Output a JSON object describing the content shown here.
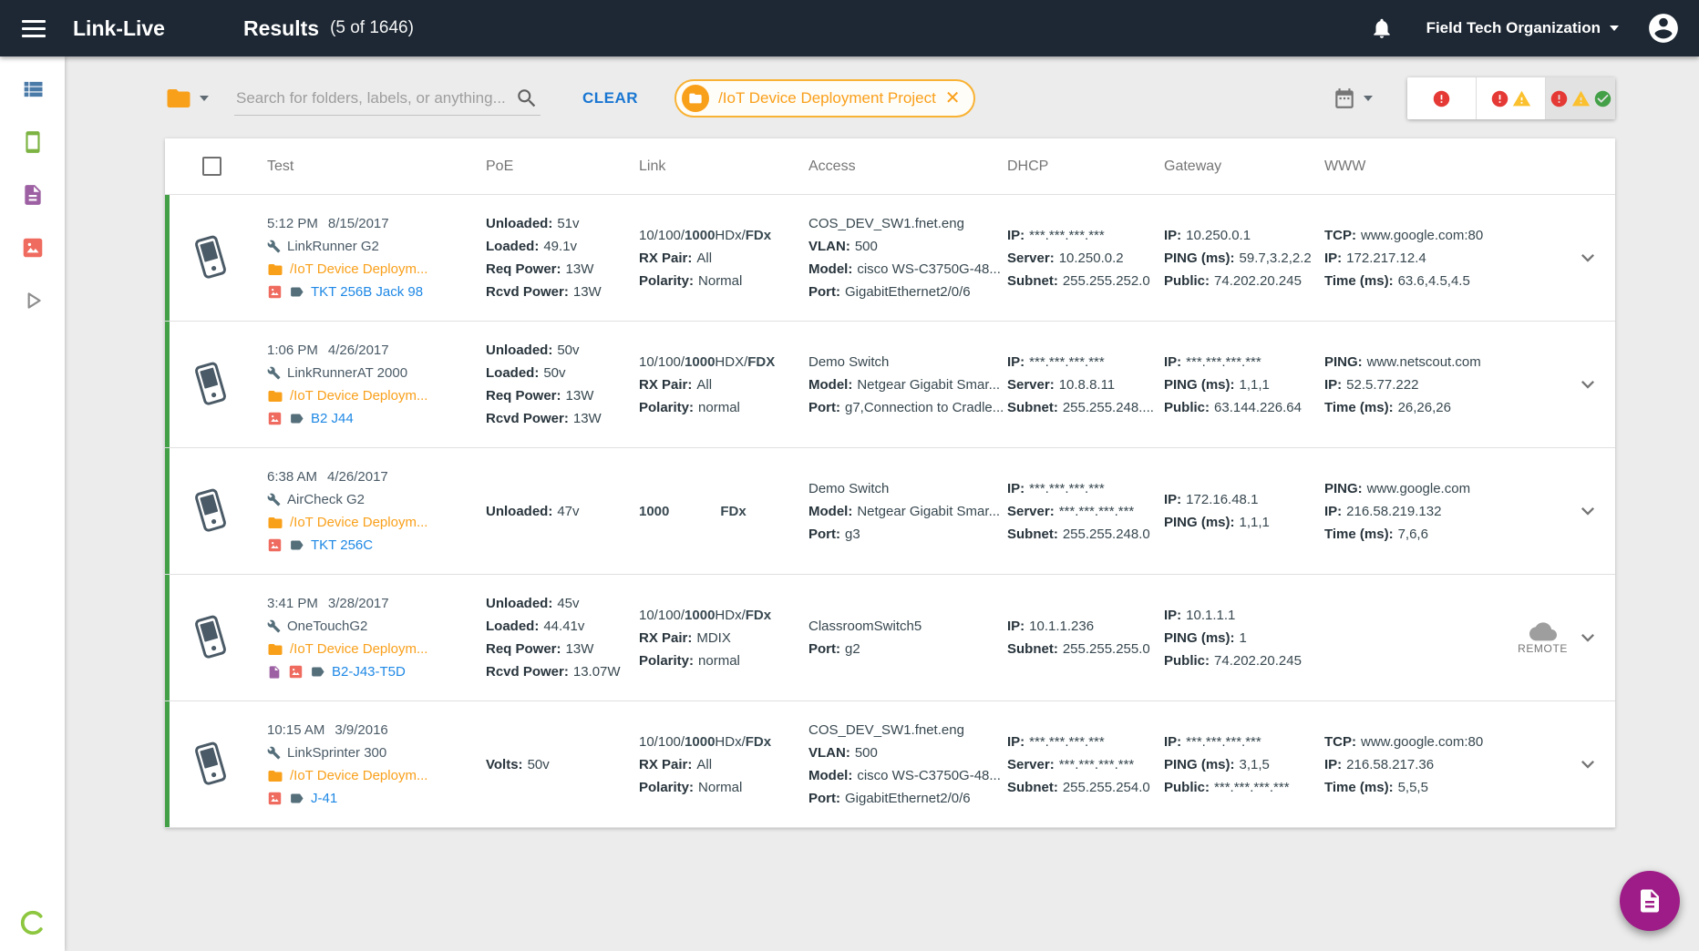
{
  "topbar": {
    "brand": "Link-Live",
    "title": "Results",
    "count": "(5 of 1646)",
    "org": "Field Tech Organization",
    "icons": [
      "menu-icon",
      "bell-icon",
      "caret-down-icon",
      "account-icon"
    ]
  },
  "sidebar": {
    "icons": [
      "view-list-icon",
      "smartphone-icon",
      "document-icon",
      "image-icon",
      "play-icon"
    ],
    "logo_icon": "ring-logo-icon"
  },
  "filters": {
    "search_placeholder": "Search for folders, labels, or anything...",
    "clear_label": "CLEAR",
    "chip": {
      "label": "/IoT Device Deployment Project",
      "icon": "folder-icon",
      "close_icon": "close-icon"
    },
    "folder_filter_icon": "folder-icon",
    "date_filter_icon": "calendar-icon",
    "status_toggles": [
      {
        "icons": [
          "error"
        ],
        "active": false
      },
      {
        "icons": [
          "error",
          "warning"
        ],
        "active": false
      },
      {
        "icons": [
          "error",
          "warning",
          "check"
        ],
        "active": true
      }
    ]
  },
  "table": {
    "columns": [
      "Test",
      "PoE",
      "Link",
      "Access",
      "DHCP",
      "Gateway",
      "WWW"
    ],
    "remote_label": "REMOTE",
    "rows": [
      {
        "time": "5:12 PM",
        "date": "8/15/2017",
        "device": "LinkRunner G2",
        "folder": "/IoT Device Deploym...",
        "label": "TKT 256B Jack 98",
        "label_icons": [
          "image",
          "tag"
        ],
        "poe": [
          {
            "label": "Unloaded:",
            "value": "51v"
          },
          {
            "label": "Loaded:",
            "value": "49.1v"
          },
          {
            "label": "Req Power:",
            "value": "13W"
          },
          {
            "label": "Rcvd Power:",
            "value": "13W"
          }
        ],
        "link_segments": [
          {
            "t": "10/100/"
          },
          {
            "t": "1000",
            "b": true
          },
          {
            "t": "HDx/"
          },
          {
            "t": "FDx",
            "b": true
          }
        ],
        "link_lines": [
          {
            "label": "RX Pair:",
            "value": "All"
          },
          {
            "label": "Polarity:",
            "value": "Normal"
          }
        ],
        "access": [
          {
            "value": "COS_DEV_SW1.fnet.eng"
          },
          {
            "label": "VLAN:",
            "value": "500"
          },
          {
            "label": "Model:",
            "value": "cisco WS-C3750G-48..."
          },
          {
            "label": "Port:",
            "value": "GigabitEthernet2/0/6"
          }
        ],
        "dhcp": [
          {
            "label": "IP:",
            "value": "***.***.***.***"
          },
          {
            "label": "Server:",
            "value": "10.250.0.2"
          },
          {
            "label": "Subnet:",
            "value": "255.255.252.0"
          }
        ],
        "gateway": [
          {
            "label": "IP:",
            "value": "10.250.0.1"
          },
          {
            "label": "PING (ms):",
            "value": "59.7,3.2,2.2"
          },
          {
            "label": "Public:",
            "value": "74.202.20.245"
          }
        ],
        "www": [
          {
            "label": "TCP:",
            "value": "www.google.com:80"
          },
          {
            "label": "IP:",
            "value": "172.217.12.4"
          },
          {
            "label": "Time (ms):",
            "value": "63.6,4.5,4.5"
          }
        ],
        "remote": false
      },
      {
        "time": "1:06 PM",
        "date": "4/26/2017",
        "device": "LinkRunnerAT 2000",
        "folder": "/IoT Device Deploym...",
        "label": "B2 J44",
        "label_icons": [
          "image",
          "tag"
        ],
        "poe": [
          {
            "label": "Unloaded:",
            "value": "50v"
          },
          {
            "label": "Loaded:",
            "value": "50v"
          },
          {
            "label": "Req Power:",
            "value": "13W"
          },
          {
            "label": "Rcvd Power:",
            "value": "13W"
          }
        ],
        "link_segments": [
          {
            "t": "10/100/"
          },
          {
            "t": "1000",
            "b": true
          },
          {
            "t": "HDX/"
          },
          {
            "t": "FDX",
            "b": true
          }
        ],
        "link_lines": [
          {
            "label": "RX Pair:",
            "value": "All"
          },
          {
            "label": "Polarity:",
            "value": "normal"
          }
        ],
        "access": [
          {
            "value": "Demo Switch"
          },
          {
            "label": "Model:",
            "value": "Netgear Gigabit Smar..."
          },
          {
            "label": "Port:",
            "value": "g7,Connection to Cradle..."
          }
        ],
        "dhcp": [
          {
            "label": "IP:",
            "value": "***.***.***.***"
          },
          {
            "label": "Server:",
            "value": "10.8.8.11"
          },
          {
            "label": "Subnet:",
            "value": "255.255.248...."
          }
        ],
        "gateway": [
          {
            "label": "IP:",
            "value": "***.***.***.***"
          },
          {
            "label": "PING (ms):",
            "value": "1,1,1"
          },
          {
            "label": "Public:",
            "value": "63.144.226.64"
          }
        ],
        "www": [
          {
            "label": "PING:",
            "value": "www.netscout.com"
          },
          {
            "label": "IP:",
            "value": "52.5.77.222"
          },
          {
            "label": "Time (ms):",
            "value": "26,26,26"
          }
        ],
        "remote": false
      },
      {
        "time": "6:38 AM",
        "date": "4/26/2017",
        "device": "AirCheck G2",
        "folder": "/IoT Device Deploym...",
        "label": "TKT 256C",
        "label_icons": [
          "image",
          "tag"
        ],
        "poe": [
          {
            "label": "Unloaded:",
            "value": "47v"
          }
        ],
        "link_segments": [
          {
            "t": "1000",
            "b": true,
            "gap": true
          },
          {
            "t": "FDx",
            "b": true
          }
        ],
        "link_lines": [],
        "access": [
          {
            "value": "Demo Switch"
          },
          {
            "label": "Model:",
            "value": "Netgear Gigabit Smar..."
          },
          {
            "label": "Port:",
            "value": "g3"
          }
        ],
        "dhcp": [
          {
            "label": "IP:",
            "value": "***.***.***.***"
          },
          {
            "label": "Server:",
            "value": "***.***.***.***"
          },
          {
            "label": "Subnet:",
            "value": "255.255.248.0"
          }
        ],
        "gateway": [
          {
            "label": "IP:",
            "value": "172.16.48.1"
          },
          {
            "label": "PING (ms):",
            "value": "1,1,1"
          }
        ],
        "www": [
          {
            "label": "PING:",
            "value": "www.google.com"
          },
          {
            "label": "IP:",
            "value": "216.58.219.132"
          },
          {
            "label": "Time (ms):",
            "value": "7,6,6"
          }
        ],
        "remote": false
      },
      {
        "time": "3:41 PM",
        "date": "3/28/2017",
        "device": "OneTouchG2",
        "folder": "/IoT Device Deploym...",
        "label": "B2-J43-T5D",
        "label_icons": [
          "file",
          "image",
          "tag"
        ],
        "poe": [
          {
            "label": "Unloaded:",
            "value": "45v"
          },
          {
            "label": "Loaded:",
            "value": "44.41v"
          },
          {
            "label": "Req Power:",
            "value": "13W"
          },
          {
            "label": "Rcvd Power:",
            "value": "13.07W"
          }
        ],
        "link_segments": [
          {
            "t": "10/100/"
          },
          {
            "t": "1000",
            "b": true
          },
          {
            "t": "HDx/"
          },
          {
            "t": "FDx",
            "b": true
          }
        ],
        "link_lines": [
          {
            "label": "RX Pair:",
            "value": "MDIX"
          },
          {
            "label": "Polarity:",
            "value": "normal"
          }
        ],
        "access": [
          {
            "value": "ClassroomSwitch5"
          },
          {
            "label": "Port:",
            "value": "g2"
          }
        ],
        "dhcp": [
          {
            "label": "IP:",
            "value": "10.1.1.236"
          },
          {
            "label": "Subnet:",
            "value": "255.255.255.0"
          }
        ],
        "gateway": [
          {
            "label": "IP:",
            "value": "10.1.1.1"
          },
          {
            "label": "PING (ms):",
            "value": "1"
          },
          {
            "label": "Public:",
            "value": "74.202.20.245"
          }
        ],
        "www": [],
        "remote": true
      },
      {
        "time": "10:15 AM",
        "date": "3/9/2016",
        "device": "LinkSprinter 300",
        "folder": "/IoT Device Deploym...",
        "label": "J-41",
        "label_icons": [
          "image",
          "tag"
        ],
        "poe": [
          {
            "label": "Volts:",
            "value": "50v"
          }
        ],
        "link_segments": [
          {
            "t": "10/100/"
          },
          {
            "t": "1000",
            "b": true
          },
          {
            "t": "HDx/"
          },
          {
            "t": "FDx",
            "b": true
          }
        ],
        "link_lines": [
          {
            "label": "RX Pair:",
            "value": "All"
          },
          {
            "label": "Polarity:",
            "value": "Normal"
          }
        ],
        "access": [
          {
            "value": "COS_DEV_SW1.fnet.eng"
          },
          {
            "label": "VLAN:",
            "value": "500"
          },
          {
            "label": "Model:",
            "value": "cisco WS-C3750G-48..."
          },
          {
            "label": "Port:",
            "value": "GigabitEthernet2/0/6"
          }
        ],
        "dhcp": [
          {
            "label": "IP:",
            "value": "***.***.***.***"
          },
          {
            "label": "Server:",
            "value": "***.***.***.***"
          },
          {
            "label": "Subnet:",
            "value": "255.255.254.0"
          }
        ],
        "gateway": [
          {
            "label": "IP:",
            "value": "***.***.***.***"
          },
          {
            "label": "PING (ms):",
            "value": "3,1,5"
          },
          {
            "label": "Public:",
            "value": "***.***.***.***"
          }
        ],
        "www": [
          {
            "label": "TCP:",
            "value": "www.google.com:80"
          },
          {
            "label": "IP:",
            "value": "216.58.217.36"
          },
          {
            "label": "Time (ms):",
            "value": "5,5,5"
          }
        ],
        "remote": false
      }
    ]
  },
  "colors": {
    "topbar": "#1d2834",
    "row_accent_green": "#43a047",
    "amber": "#f9a01b",
    "link_blue": "#1e88e5",
    "coral_image": "#ef6b5f",
    "purple_file": "#9d61a3",
    "fab_purple": "#9e1c87",
    "error_red": "#e53935",
    "warning_yellow": "#fbc02d",
    "ok_green": "#43a047"
  }
}
